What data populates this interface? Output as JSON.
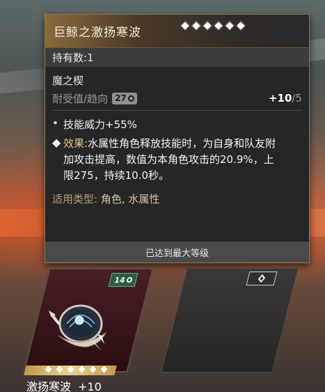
{
  "tooltip": {
    "title": "巨鲸之激扬寒波",
    "owned": "持有数:1",
    "set_name": "魔之楔",
    "preference_label": "耐受值/趋向",
    "preference_value": "27",
    "level": "+10",
    "level_max": "/5",
    "skill_bullet": "•",
    "skill": "技能威力+55%",
    "effect_bullet": "◆",
    "effect_lead": "效果:",
    "effect_text": "水属性角色释放技能时，为自身和队友附加攻击提高，数值为本角色攻击的20.9%，上限275，持续10.0秒。",
    "types_label": "适用类型:",
    "types_value": "角色, 水属性",
    "max_level": "已达到最大等级"
  },
  "cards": [
    {
      "name": "激扬寒波",
      "level": "+10",
      "badge": "14",
      "badge_color": "#2f5b45"
    },
    {
      "name": "",
      "empty": true
    }
  ],
  "colors": {
    "accent_gold": "#c49a4a",
    "effect_lead": "#e8c38a",
    "panel_bg": "#262626"
  }
}
